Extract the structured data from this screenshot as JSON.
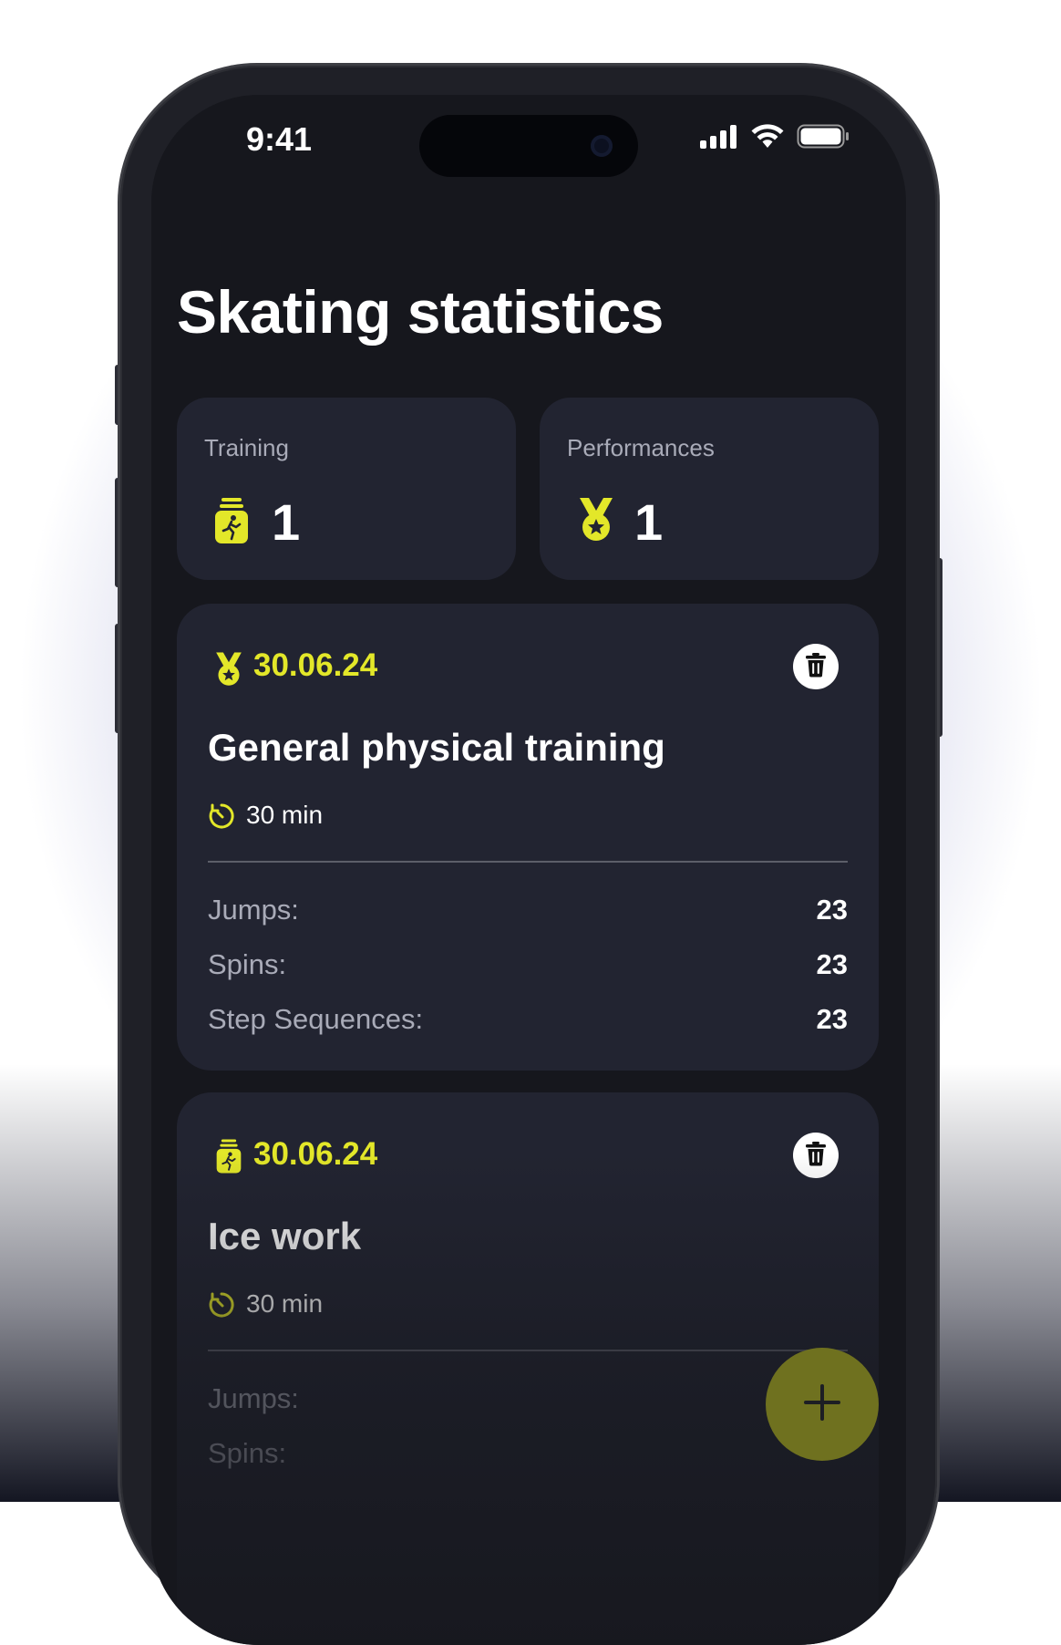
{
  "status_bar": {
    "time": "9:41"
  },
  "page": {
    "title": "Skating statistics"
  },
  "summary": {
    "training": {
      "label": "Training",
      "count": "1"
    },
    "performances": {
      "label": "Performances",
      "count": "1"
    }
  },
  "entries": [
    {
      "type": "performance",
      "date": "30.06.24",
      "name": "General physical training",
      "duration": "30 min",
      "stats": [
        {
          "label": "Jumps:",
          "value": "23"
        },
        {
          "label": "Spins:",
          "value": "23"
        },
        {
          "label": "Step Sequences:",
          "value": "23"
        }
      ]
    },
    {
      "type": "training",
      "date": "30.06.24",
      "name": "Ice work",
      "duration": "30 min",
      "stats": [
        {
          "label": "Jumps:",
          "value": ""
        },
        {
          "label": "Spins:",
          "value": ""
        }
      ]
    }
  ],
  "colors": {
    "accent": "#e3e729",
    "card": "#222431",
    "screen": "#16171d"
  },
  "icons": [
    "signal-icon",
    "wifi-icon",
    "battery-icon",
    "medal-icon",
    "training-jar-icon",
    "timer-icon",
    "trash-icon",
    "plus-icon"
  ]
}
